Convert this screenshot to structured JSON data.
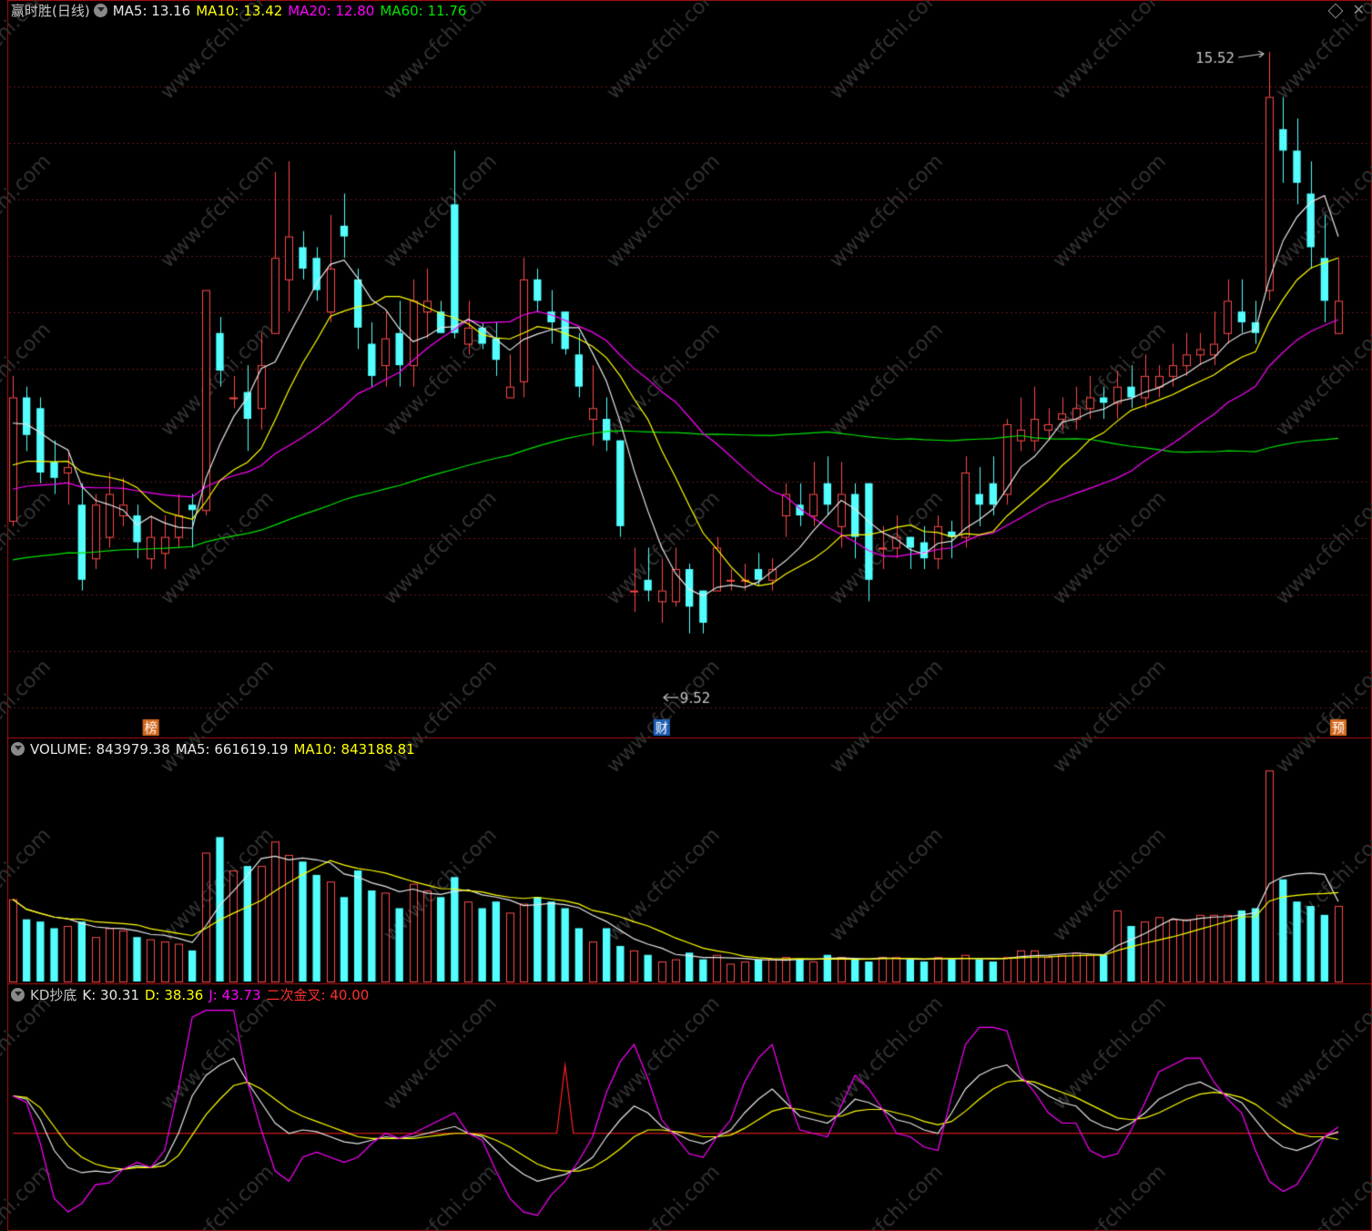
{
  "colors": {
    "up": "#ff4a4a",
    "down": "#54ffff",
    "ma5": "#e6e6e6",
    "ma10": "#ffff00",
    "ma20": "#ff00ff",
    "ma60": "#00e400",
    "grid": "#6a1818",
    "watermark": "#333333"
  },
  "header": {
    "title": "赢时胜(日线)",
    "ma5": "MA5: 13.16",
    "ma10": "MA10: 13.42",
    "ma20": "MA20: 12.80",
    "ma60": "MA60: 11.76"
  },
  "volume_header": {
    "title": "VOLUME: 843979.38",
    "ma5": "MA5: 661619.19",
    "ma10": "MA10: 843188.81"
  },
  "kd_header": {
    "title": "KD抄底",
    "k": "K: 30.31",
    "d": "D: 38.36",
    "j": "J: 43.73",
    "cross": "二次金叉: 40.00"
  },
  "markers": [
    {
      "label": "榜",
      "index": 10,
      "color": "#d2691e"
    },
    {
      "label": "财",
      "index": 47,
      "color": "#1e5fb4"
    },
    {
      "label": "预",
      "index": 96,
      "color": "#d2691e"
    }
  ],
  "watermark": "www.cfchi.com",
  "chart_data": [
    {
      "type": "candlestick",
      "annotations": [
        {
          "text": "15.52",
          "kind": "high",
          "index": 91,
          "value": 15.52
        },
        {
          "text": "9.52",
          "kind": "low",
          "index": 47,
          "value": 9.52
        }
      ],
      "ylim": [
        9.3,
        15.8
      ],
      "candles": [
        [
          11.15,
          12.3,
          12.5,
          11.1
        ],
        [
          12.3,
          11.95,
          12.4,
          11.8
        ],
        [
          12.2,
          11.6,
          12.3,
          11.5
        ],
        [
          11.7,
          11.55,
          11.9,
          11.4
        ],
        [
          11.6,
          11.65,
          11.8,
          11.3
        ],
        [
          11.3,
          10.6,
          11.5,
          10.5
        ],
        [
          10.8,
          11.3,
          11.4,
          10.7
        ],
        [
          11,
          11.4,
          11.6,
          10.9
        ],
        [
          11.2,
          11.3,
          11.55,
          11.1
        ],
        [
          11.2,
          10.95,
          11.3,
          10.8
        ],
        [
          10.8,
          11,
          11.2,
          10.7
        ],
        [
          10.85,
          11,
          11.2,
          10.7
        ],
        [
          11,
          11.2,
          11.4,
          10.9
        ],
        [
          11.3,
          11.25,
          11.4,
          10.9
        ],
        [
          11.25,
          13.3,
          13.3,
          11.2
        ],
        [
          12.9,
          12.55,
          13.05,
          12.4
        ],
        [
          12.3,
          12.3,
          12.5,
          12.2
        ],
        [
          12.35,
          12.1,
          12.6,
          11.8
        ],
        [
          12.2,
          12.6,
          12.9,
          12.0
        ],
        [
          12.9,
          13.6,
          14.4,
          12.9
        ],
        [
          13.4,
          13.8,
          14.5,
          13.1
        ],
        [
          13.7,
          13.5,
          13.85,
          13.4
        ],
        [
          13.6,
          13.3,
          13.7,
          13.2
        ],
        [
          13.1,
          13.5,
          14.0,
          13.0
        ],
        [
          13.9,
          13.8,
          14.2,
          13.6
        ],
        [
          13.4,
          12.95,
          13.5,
          12.75
        ],
        [
          12.8,
          12.5,
          13.0,
          12.4
        ],
        [
          12.6,
          12.85,
          13.1,
          12.4
        ],
        [
          12.9,
          12.6,
          13.2,
          12.4
        ],
        [
          12.6,
          13.2,
          13.4,
          12.4
        ],
        [
          13.1,
          13.2,
          13.5,
          12.85
        ],
        [
          13.1,
          12.9,
          13.2,
          12.9
        ],
        [
          14.1,
          12.9,
          14.6,
          12.85
        ],
        [
          12.8,
          12.95,
          13.2,
          12.7
        ],
        [
          12.95,
          12.8,
          13.0,
          12.75
        ],
        [
          12.85,
          12.65,
          13.0,
          12.5
        ],
        [
          12.3,
          12.4,
          12.7,
          12.3
        ],
        [
          12.45,
          13.4,
          13.6,
          12.3
        ],
        [
          13.4,
          13.2,
          13.5,
          13.1
        ],
        [
          13.1,
          13.0,
          13.3,
          12.8
        ],
        [
          13.1,
          12.75,
          13.1,
          12.7
        ],
        [
          12.7,
          12.4,
          12.9,
          12.3
        ],
        [
          12.1,
          12.2,
          12.6,
          11.85
        ],
        [
          12.1,
          11.9,
          12.3,
          11.8
        ],
        [
          11.9,
          11.1,
          11.9,
          11.0
        ],
        [
          10.5,
          10.5,
          10.9,
          10.3
        ],
        [
          10.6,
          10.5,
          10.9,
          10.4
        ],
        [
          10.4,
          10.5,
          10.8,
          10.2
        ],
        [
          10.4,
          10.7,
          10.9,
          10.35
        ],
        [
          10.7,
          10.35,
          10.75,
          10.1
        ],
        [
          10.5,
          10.2,
          10.5,
          10.1
        ],
        [
          10.5,
          10.9,
          11.0,
          10.5
        ],
        [
          10.6,
          10.6,
          10.7,
          10.5
        ],
        [
          10.6,
          10.6,
          10.75,
          10.5
        ],
        [
          10.7,
          10.6,
          10.85,
          10.55
        ],
        [
          10.6,
          10.7,
          10.8,
          10.5
        ],
        [
          11.2,
          11.4,
          11.5,
          11.0
        ],
        [
          11.3,
          11.2,
          11.5,
          11.1
        ],
        [
          11.2,
          11.4,
          11.7,
          11.1
        ],
        [
          11.5,
          11.3,
          11.75,
          11.2
        ],
        [
          11.1,
          11.4,
          11.7,
          10.9
        ],
        [
          11.4,
          11.0,
          11.5,
          10.8
        ],
        [
          11.5,
          10.6,
          11.5,
          10.4
        ],
        [
          10.9,
          10.9,
          11.1,
          10.7
        ],
        [
          10.9,
          11.0,
          11.2,
          10.8
        ],
        [
          11.0,
          10.9,
          11.0,
          10.7
        ],
        [
          10.95,
          10.8,
          11.1,
          10.7
        ],
        [
          10.8,
          11.1,
          11.2,
          10.7
        ],
        [
          11.05,
          11.0,
          11.15,
          10.8
        ],
        [
          11.0,
          11.6,
          11.75,
          10.9
        ],
        [
          11.4,
          11.3,
          11.65,
          11.1
        ],
        [
          11.5,
          11.3,
          11.75,
          11.2
        ],
        [
          11.4,
          12.05,
          12.1,
          11.3
        ],
        [
          11.9,
          12.0,
          12.3,
          11.8
        ],
        [
          11.9,
          12.1,
          12.4,
          11.8
        ],
        [
          12.0,
          12.05,
          12.2,
          11.9
        ],
        [
          12.1,
          12.15,
          12.3,
          12.0
        ],
        [
          12.1,
          12.2,
          12.4,
          12.0
        ],
        [
          12.2,
          12.3,
          12.5,
          12.1
        ],
        [
          12.3,
          12.25,
          12.4,
          12.1
        ],
        [
          12.25,
          12.4,
          12.55,
          12.1
        ],
        [
          12.4,
          12.3,
          12.6,
          12.2
        ],
        [
          12.3,
          12.5,
          12.7,
          12.2
        ],
        [
          12.4,
          12.5,
          12.6,
          12.3
        ],
        [
          12.5,
          12.6,
          12.8,
          12.4
        ],
        [
          12.6,
          12.7,
          12.9,
          12.5
        ],
        [
          12.7,
          12.75,
          12.9,
          12.6
        ],
        [
          12.7,
          12.8,
          13.1,
          12.6
        ],
        [
          12.9,
          13.2,
          13.4,
          12.8
        ],
        [
          13.1,
          13.0,
          13.4,
          12.9
        ],
        [
          13.0,
          12.9,
          13.2,
          12.8
        ],
        [
          13.3,
          15.1,
          15.52,
          13.2
        ],
        [
          14.8,
          14.6,
          15.1,
          14.3
        ],
        [
          14.6,
          14.3,
          14.9,
          14.1
        ],
        [
          14.2,
          13.7,
          14.5,
          13.5
        ],
        [
          13.6,
          13.2,
          14.0,
          13.0
        ],
        [
          12.9,
          13.2,
          13.6,
          12.9
        ]
      ]
    },
    {
      "type": "bar",
      "title": "VOLUME",
      "values": [
        37,
        28,
        27,
        24,
        25,
        27,
        20,
        24,
        23,
        20,
        19,
        18,
        17,
        14,
        58,
        65,
        50,
        52,
        52,
        63,
        57,
        54,
        48,
        45,
        38,
        50,
        41,
        40,
        33,
        44,
        41,
        38,
        47,
        36,
        33,
        36,
        31,
        35,
        38,
        36,
        33,
        24,
        18,
        24,
        16,
        14,
        12,
        9,
        10,
        13,
        10,
        12,
        8,
        9,
        10,
        10,
        11,
        10,
        9,
        12,
        11,
        10,
        9,
        11,
        11,
        10,
        9,
        11,
        10,
        12,
        10,
        9,
        11,
        14,
        14,
        11,
        12,
        13,
        12,
        12,
        32,
        25,
        27,
        29,
        28,
        28,
        30,
        30,
        30,
        32,
        33,
        95,
        46,
        36,
        34,
        30,
        34
      ]
    },
    {
      "type": "line",
      "title": "KD抄底",
      "ylim": [
        0,
        100
      ],
      "series": [
        {
          "name": "K",
          "values": [
            62,
            60,
            48,
            30,
            20,
            17,
            18,
            17,
            19,
            21,
            20,
            24,
            40,
            62,
            74,
            80,
            84,
            70,
            58,
            46,
            40,
            42,
            41,
            38,
            35,
            34,
            36,
            38,
            37,
            38,
            40,
            42,
            44,
            40,
            38,
            30,
            22,
            16,
            12,
            14,
            16,
            20,
            26,
            38,
            48,
            56,
            52,
            44,
            40,
            36,
            34,
            38,
            42,
            52,
            60,
            66,
            58,
            50,
            48,
            46,
            52,
            60,
            58,
            54,
            48,
            46,
            42,
            40,
            52,
            66,
            74,
            78,
            80,
            72,
            68,
            62,
            58,
            56,
            48,
            44,
            42,
            46,
            52,
            60,
            64,
            68,
            70,
            66,
            62,
            58,
            48,
            38,
            32,
            30,
            33,
            38,
            41
          ]
        },
        {
          "name": "D",
          "values": [
            62,
            61,
            55,
            44,
            33,
            26,
            22,
            20,
            19,
            20,
            20,
            21,
            27,
            39,
            51,
            60,
            68,
            70,
            66,
            60,
            54,
            50,
            47,
            44,
            41,
            38,
            37,
            37,
            37,
            37,
            38,
            39,
            40,
            40,
            39,
            36,
            32,
            27,
            22,
            19,
            18,
            18,
            20,
            25,
            31,
            38,
            42,
            42,
            41,
            40,
            38,
            38,
            39,
            43,
            48,
            53,
            55,
            54,
            52,
            50,
            50,
            53,
            54,
            54,
            52,
            50,
            47,
            45,
            47,
            53,
            60,
            66,
            70,
            71,
            70,
            67,
            64,
            61,
            57,
            53,
            49,
            48,
            49,
            52,
            56,
            60,
            63,
            64,
            63,
            61,
            57,
            51,
            45,
            40,
            38,
            38,
            36.4
          ]
        },
        {
          "name": "J",
          "values": [
            62,
            58,
            34,
            2,
            -6,
            -1,
            10,
            11,
            19,
            23,
            20,
            30,
            66,
            108,
            120,
            120,
            116,
            70,
            42,
            18,
            12,
            26,
            29,
            26,
            23,
            26,
            34,
            40,
            37,
            40,
            44,
            48,
            52,
            40,
            36,
            18,
            2,
            -6,
            -8,
            4,
            12,
            24,
            38,
            64,
            82,
            92,
            72,
            48,
            38,
            28,
            26,
            38,
            48,
            70,
            84,
            92,
            64,
            42,
            40,
            38,
            56,
            74,
            66,
            54,
            40,
            38,
            32,
            30,
            62,
            92,
            102,
            102,
            100,
            74,
            64,
            52,
            46,
            46,
            30,
            26,
            28,
            42,
            58,
            76,
            80,
            84,
            84,
            70,
            60,
            52,
            30,
            12,
            6,
            10,
            23,
            38,
            43.73
          ]
        }
      ],
      "cross_line": 40
    }
  ]
}
